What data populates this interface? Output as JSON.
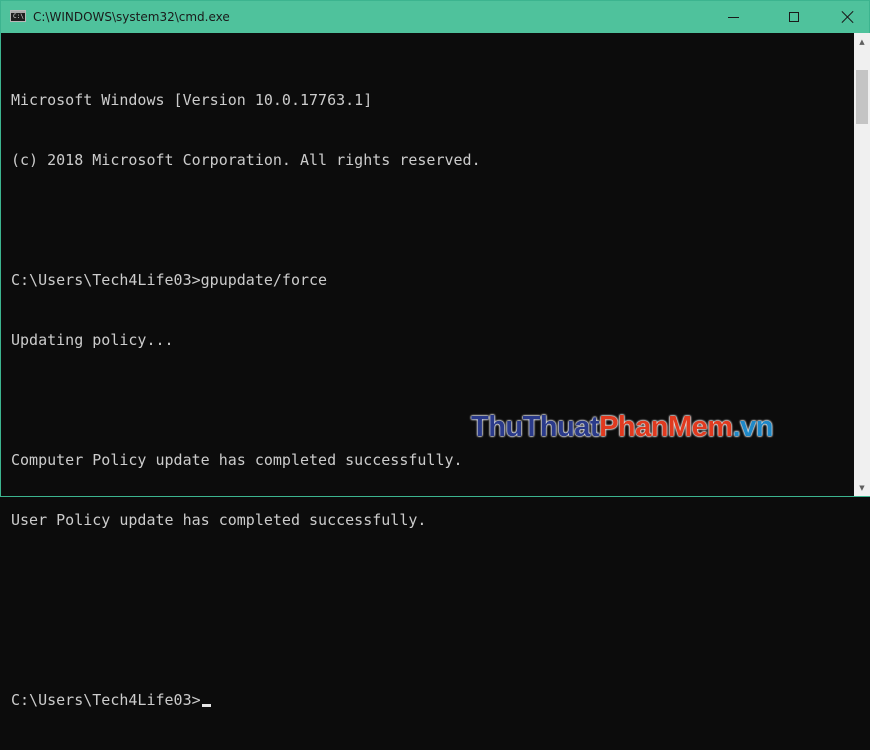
{
  "window": {
    "title": "C:\\WINDOWS\\system32\\cmd.exe",
    "icon_label": "C:\\",
    "titlebar_color": "#4fc29c",
    "background_color": "#0c0c0c",
    "text_color": "#cccccc"
  },
  "titlebar_buttons": {
    "minimize": "minimize-icon",
    "maximize": "maximize-icon",
    "close": "close-icon"
  },
  "console": {
    "lines": [
      "Microsoft Windows [Version 10.0.17763.1]",
      "(c) 2018 Microsoft Corporation. All rights reserved.",
      "",
      "C:\\Users\\Tech4Life03>gpupdate/force",
      "Updating policy...",
      "",
      "Computer Policy update has completed successfully.",
      "User Policy update has completed successfully.",
      "",
      "",
      "C:\\Users\\Tech4Life03>"
    ]
  },
  "scrollbar": {
    "up_icon": "scroll-up-arrow-icon",
    "down_icon": "scroll-down-arrow-icon"
  },
  "watermark": {
    "part1": "ThuThuat",
    "part2": "PhanMem",
    "part3": ".vn"
  }
}
